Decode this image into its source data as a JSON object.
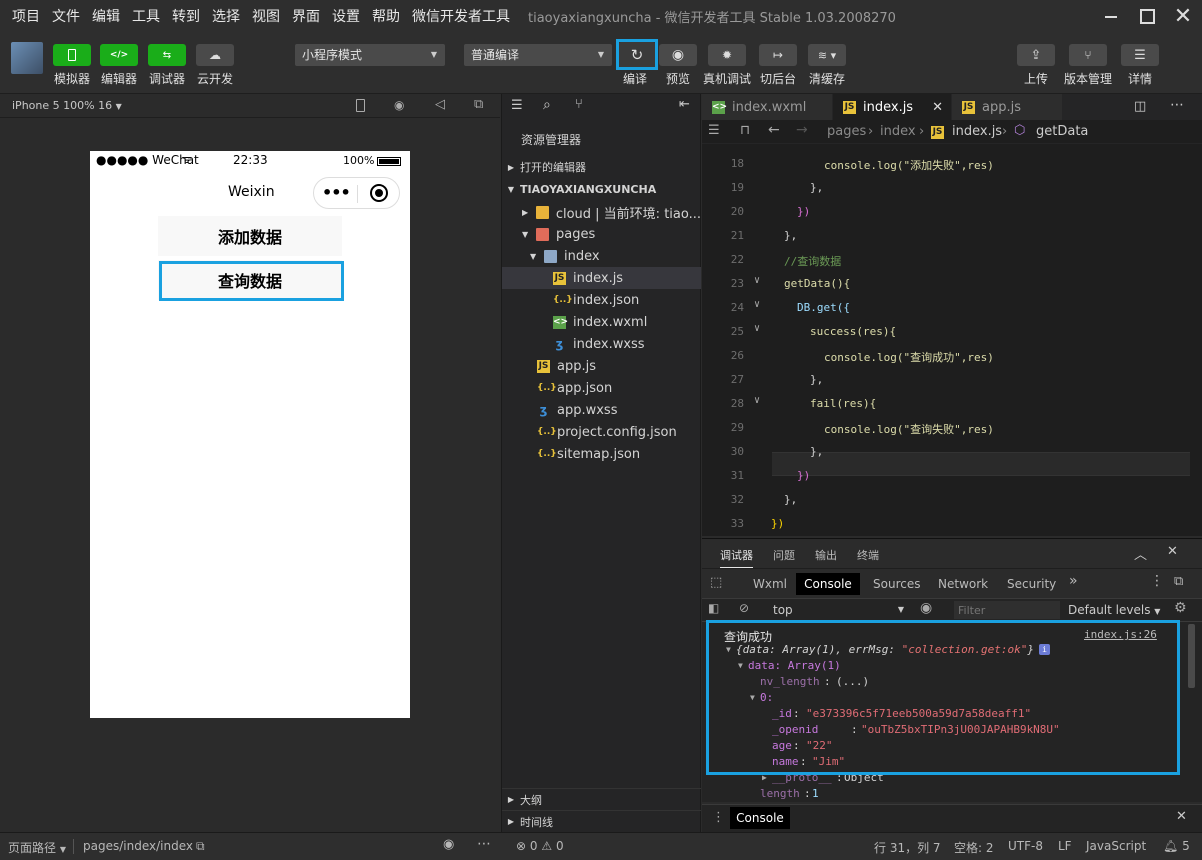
{
  "menubar": {
    "items": [
      "项目",
      "文件",
      "编辑",
      "工具",
      "转到",
      "选择",
      "视图",
      "界面",
      "设置",
      "帮助",
      "微信开发者工具"
    ],
    "window_title": "tiaoyaxiangxuncha - 微信开发者工具 Stable 1.03.2008270"
  },
  "toolbar": {
    "simulator": "模拟器",
    "editor": "编辑器",
    "debugger": "调试器",
    "cloud": "云开发",
    "mode_select": "小程序模式",
    "compile_select": "普通编译",
    "compile": "编译",
    "preview": "预览",
    "real_debug": "真机调试",
    "background": "切后台",
    "clear_cache": "清缓存",
    "upload": "上传",
    "version": "版本管理",
    "details": "详情"
  },
  "simulator": {
    "device": "iPhone 5 100% 16",
    "status_carrier": "●●●●● WeChat",
    "status_time": "22:33",
    "status_battery": "100%",
    "nav_title": "Weixin",
    "capsule_dots": "•••",
    "btn_add": "添加数据",
    "btn_query": "查询数据"
  },
  "explorer": {
    "title": "资源管理器",
    "open_editors": "打开的编辑器",
    "project": "TIAOYAXIANGXUNCHA",
    "rows": [
      {
        "name": "cloud | 当前环境: tiao...",
        "icon": "folder"
      },
      {
        "name": "pages",
        "icon": "folder-red"
      },
      {
        "name": "index",
        "icon": "folder-open"
      },
      {
        "name": "index.js",
        "icon": "js"
      },
      {
        "name": "index.json",
        "icon": "json"
      },
      {
        "name": "index.wxml",
        "icon": "wxml"
      },
      {
        "name": "index.wxss",
        "icon": "css"
      },
      {
        "name": "app.js",
        "icon": "js"
      },
      {
        "name": "app.json",
        "icon": "json"
      },
      {
        "name": "app.wxss",
        "icon": "css"
      },
      {
        "name": "project.config.json",
        "icon": "json"
      },
      {
        "name": "sitemap.json",
        "icon": "json"
      }
    ],
    "outline": "大纲",
    "timeline": "时间线"
  },
  "editor": {
    "tabs": [
      "index.wxml",
      "index.js",
      "app.js"
    ],
    "breadcrumb": [
      "pages",
      "index",
      "index.js",
      "getData"
    ],
    "lines": [
      {
        "n": "18",
        "t": "console.log(\"添加失败\",res)"
      },
      {
        "n": "19",
        "t": "},"
      },
      {
        "n": "20",
        "t": "})"
      },
      {
        "n": "21",
        "t": "},"
      },
      {
        "n": "22",
        "t": "//查询数据"
      },
      {
        "n": "23",
        "t": "getData(){"
      },
      {
        "n": "24",
        "t": "DB.get({"
      },
      {
        "n": "25",
        "t": "success(res){"
      },
      {
        "n": "26",
        "t": "console.log(\"查询成功\",res)"
      },
      {
        "n": "27",
        "t": "},"
      },
      {
        "n": "28",
        "t": "fail(res){"
      },
      {
        "n": "29",
        "t": "console.log(\"查询失败\",res)"
      },
      {
        "n": "30",
        "t": "},"
      },
      {
        "n": "31",
        "t": "})"
      },
      {
        "n": "32",
        "t": "},"
      },
      {
        "n": "33",
        "t": "})"
      }
    ]
  },
  "devtools": {
    "top_tabs": [
      "调试器",
      "问题",
      "输出",
      "终端"
    ],
    "panel_tabs": [
      "Wxml",
      "Console",
      "Sources",
      "Network",
      "Security"
    ],
    "context": "top",
    "filter_placeholder": "Filter",
    "levels": "Default levels"
  },
  "console": {
    "message": "查询成功",
    "source": "index.js:26",
    "obj_summary_a": "{data: Array(1), errMsg: ",
    "obj_summary_b": "\"collection.get:ok\"",
    "obj_summary_c": "}",
    "data_line": "data: Array(1)",
    "nv_key": "nv_length",
    "nv_val": "(...)",
    "idx": "0:",
    "id_key": "_id",
    "id_val": "\"e373396c5f71eeb500a59d7a58deaff1\"",
    "openid_key": "_openid",
    "openid_val": "\"ouTbZ5bxTIPn3jU00JAPAHB9kN8U\"",
    "age_key": "age",
    "age_val": "\"22\"",
    "name_key": "name",
    "name_val": "\"Jim\"",
    "proto_key": "__proto__",
    "proto_val": "Object",
    "len_key": "length",
    "len_val": "1",
    "drawer_tab": "Console"
  },
  "statusbar": {
    "page_path_label": "页面路径",
    "page_path": "pages/index/index",
    "errors": "0",
    "warnings": "0",
    "cursor": "行 31，列 7",
    "spaces": "空格: 2",
    "encoding": "UTF-8",
    "eol": "LF",
    "language": "JavaScript",
    "notifications": "5"
  },
  "colors": {
    "accent_green": "#1aad19",
    "highlight_blue": "#1aa1e0"
  }
}
